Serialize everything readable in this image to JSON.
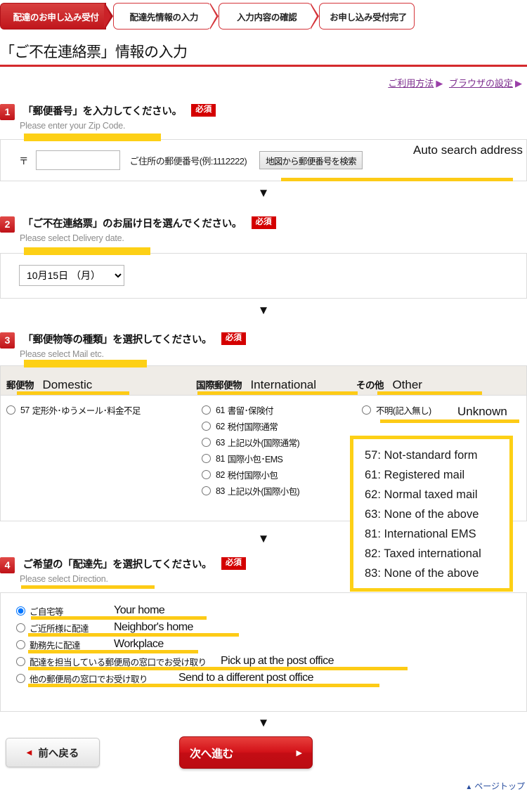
{
  "steps": [
    {
      "label": "配達のお申し込み受付",
      "active": true
    },
    {
      "label": "配達先情報の入力",
      "active": false
    },
    {
      "label": "入力内容の確認",
      "active": false
    },
    {
      "label": "お申し込み受付完了",
      "active": false
    }
  ],
  "page_title": "「ご不在連絡票」情報の入力",
  "top_links": [
    {
      "label": "ご利用方法",
      "arrow": "▶"
    },
    {
      "label": "ブラウザの設定",
      "arrow": "▶"
    }
  ],
  "required_badge": "必須",
  "section1": {
    "number": "1",
    "title": "「郵便番号」を入力してください。",
    "subtitle": "Please enter your Zip Code.",
    "zip_mark": "〒",
    "zip_value": "",
    "zip_placeholder": "",
    "zip_note": "ご住所の郵便番号(例:1112222)",
    "map_button": "地図から郵便番号を検索",
    "annotation": "Auto search address"
  },
  "section2": {
    "number": "2",
    "title": "「ご不在連絡票」のお届け日を選んでください。",
    "subtitle": "Please select Delivery date.",
    "date_selected": "10月15日 （月）"
  },
  "section3": {
    "number": "3",
    "title": "「郵便物等の種類」を選択してください。",
    "subtitle": "Please select Mail etc.",
    "columns": [
      {
        "jp": "郵便物",
        "en": "Domestic"
      },
      {
        "jp": "国際郵便物",
        "en": "International"
      },
      {
        "jp": "その他",
        "en": "Other"
      }
    ],
    "domestic_options": [
      {
        "code": "57",
        "label": "定形外･ゆうメール･料金不足"
      }
    ],
    "international_options": [
      {
        "code": "61",
        "label": "書留･保険付"
      },
      {
        "code": "62",
        "label": "税付国際通常"
      },
      {
        "code": "63",
        "label": "上記以外(国際通常)"
      },
      {
        "code": "81",
        "label": "国際小包･EMS"
      },
      {
        "code": "82",
        "label": "税付国際小包"
      },
      {
        "code": "83",
        "label": "上記以外(国際小包)"
      }
    ],
    "other_options": [
      {
        "code": "",
        "label": "不明(記入無し)",
        "annotation": "Unknown"
      }
    ],
    "callout_lines": [
      "57: Not-standard form",
      "61: Registered mail",
      "62: Normal taxed mail",
      "63: None of the above",
      "81: International EMS",
      "82: Taxed international",
      "83: None of the above"
    ]
  },
  "section4": {
    "number": "4",
    "title": "ご希望の「配達先」を選択してください。",
    "subtitle": "Please select Direction.",
    "options": [
      {
        "jp": "ご自宅等",
        "en": "Your home",
        "checked": true
      },
      {
        "jp": "ご近所様に配達",
        "en": "Neighbor's home",
        "checked": false
      },
      {
        "jp": "勤務先に配達",
        "en": "Workplace",
        "checked": false
      },
      {
        "jp": "配達を担当している郵便局の窓口でお受け取り",
        "en": "Pick up at the post office",
        "checked": false
      },
      {
        "jp": "他の郵便局の窓口でお受け取り",
        "en": "Send to a different post office",
        "checked": false
      }
    ]
  },
  "buttons": {
    "back": "前へ戻る",
    "back_arrow": "◀",
    "next": "次へ進む",
    "next_arrow": "▶"
  },
  "page_top": {
    "label": "ページトップ",
    "arrow": "▲"
  },
  "arrow_down": "▼",
  "colors": {
    "brand_red": "#c8151b",
    "highlight_yellow": "#fdd016",
    "link_purple": "#7c2d8e",
    "pagetop_blue": "#2a4fa0"
  }
}
